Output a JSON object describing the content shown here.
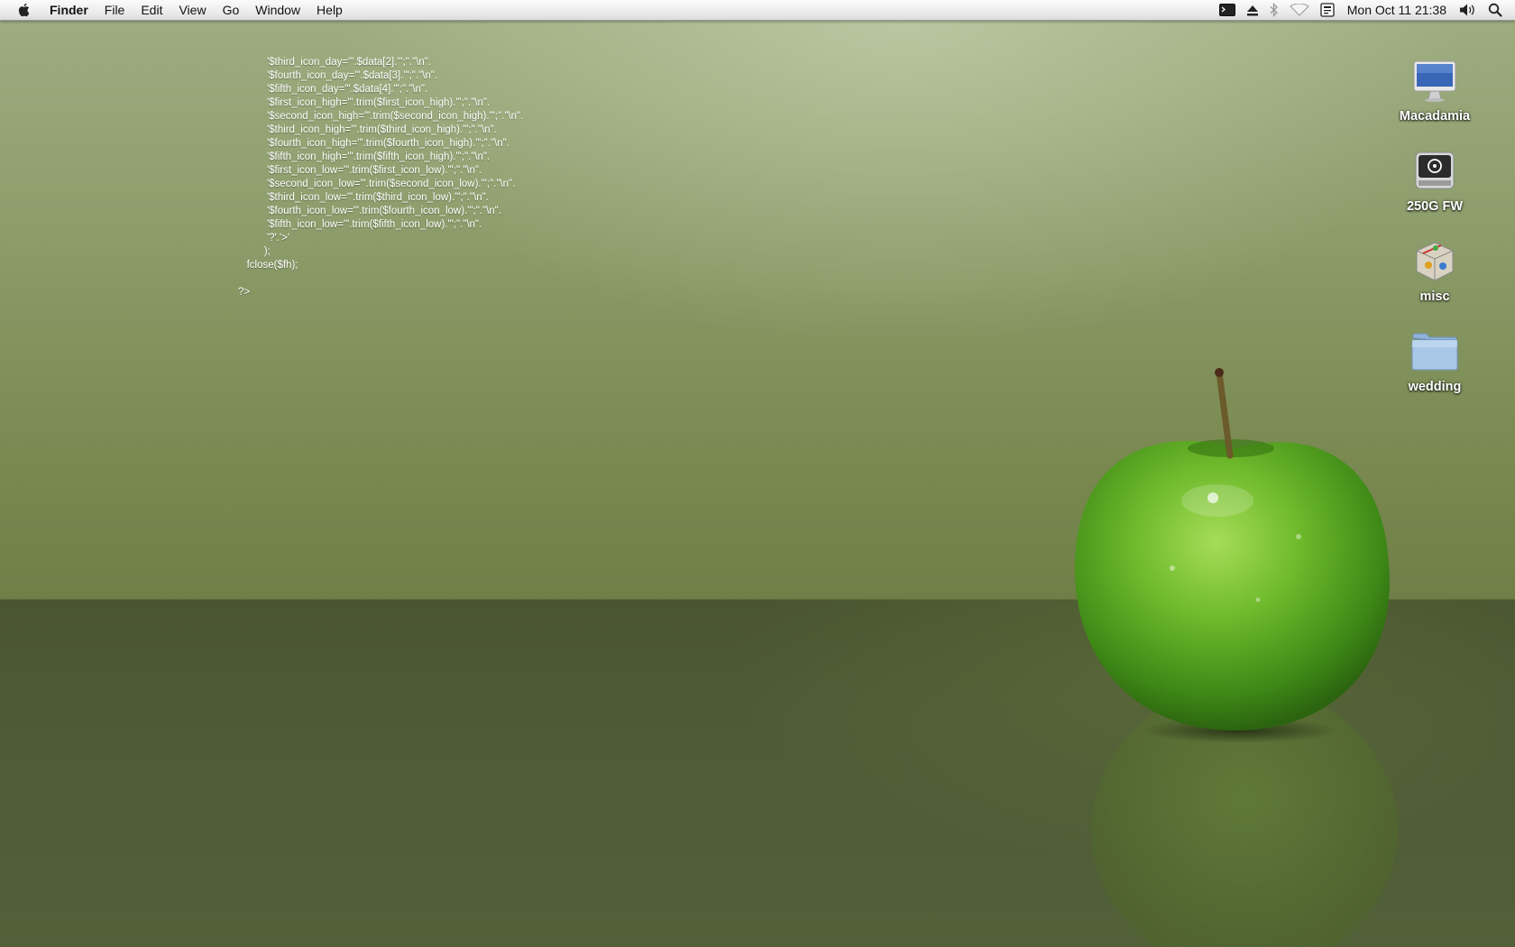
{
  "menubar": {
    "apple_icon": "apple-logo-icon",
    "items": [
      {
        "label": "Finder",
        "bold": true
      },
      {
        "label": "File"
      },
      {
        "label": "Edit"
      },
      {
        "label": "View"
      },
      {
        "label": "Go"
      },
      {
        "label": "Window"
      },
      {
        "label": "Help"
      }
    ],
    "status_icons": [
      "terminal-icon",
      "eject-icon",
      "bluetooth-icon",
      "wifi-icon",
      "input-menu-icon"
    ],
    "clock": "Mon Oct 11  21:38",
    "volume_icon": "volume-icon",
    "spotlight_icon": "spotlight-search-icon"
  },
  "code_lines": [
    "          '$third_icon_day='\".$data[2].\"';\".\"\\n\".",
    "          '$fourth_icon_day='\".$data[3].\"';\".\"\\n\".",
    "          '$fifth_icon_day='\".$data[4].\"';\".\"\\n\".",
    "          '$first_icon_high='\".trim($first_icon_high).\"';\".\"\\n\".",
    "          '$second_icon_high='\".trim($second_icon_high).\"';\".\"\\n\".",
    "          '$third_icon_high='\".trim($third_icon_high).\"';\".\"\\n\".",
    "          '$fourth_icon_high='\".trim($fourth_icon_high).\"';\".\"\\n\".",
    "          '$fifth_icon_high='\".trim($fifth_icon_high).\"';\".\"\\n\".",
    "          '$first_icon_low='\".trim($first_icon_low).\"';\".\"\\n\".",
    "          '$second_icon_low='\".trim($second_icon_low).\"';\".\"\\n\".",
    "          '$third_icon_low='\".trim($third_icon_low).\"';\".\"\\n\".",
    "          '$fourth_icon_low='\".trim($fourth_icon_low).\"';\".\"\\n\".",
    "          '$fifth_icon_low='\".trim($fifth_icon_low).\"';\".\"\\n\".",
    "          '?'.'>'",
    "         );",
    "   fclose($fh);",
    "",
    "?>"
  ],
  "desktop_icons": [
    {
      "label": "Macadamia",
      "icon": "imac-computer-icon"
    },
    {
      "label": "250G FW",
      "icon": "firewire-drive-icon"
    },
    {
      "label": "misc",
      "icon": "package-box-icon"
    },
    {
      "label": "wedding",
      "icon": "folder-icon"
    }
  ],
  "wallpaper": {
    "subject": "green apple",
    "colors": {
      "wall": "#8c9c6a",
      "floor": "#4e5a35",
      "apple": "#6cb52c"
    }
  }
}
